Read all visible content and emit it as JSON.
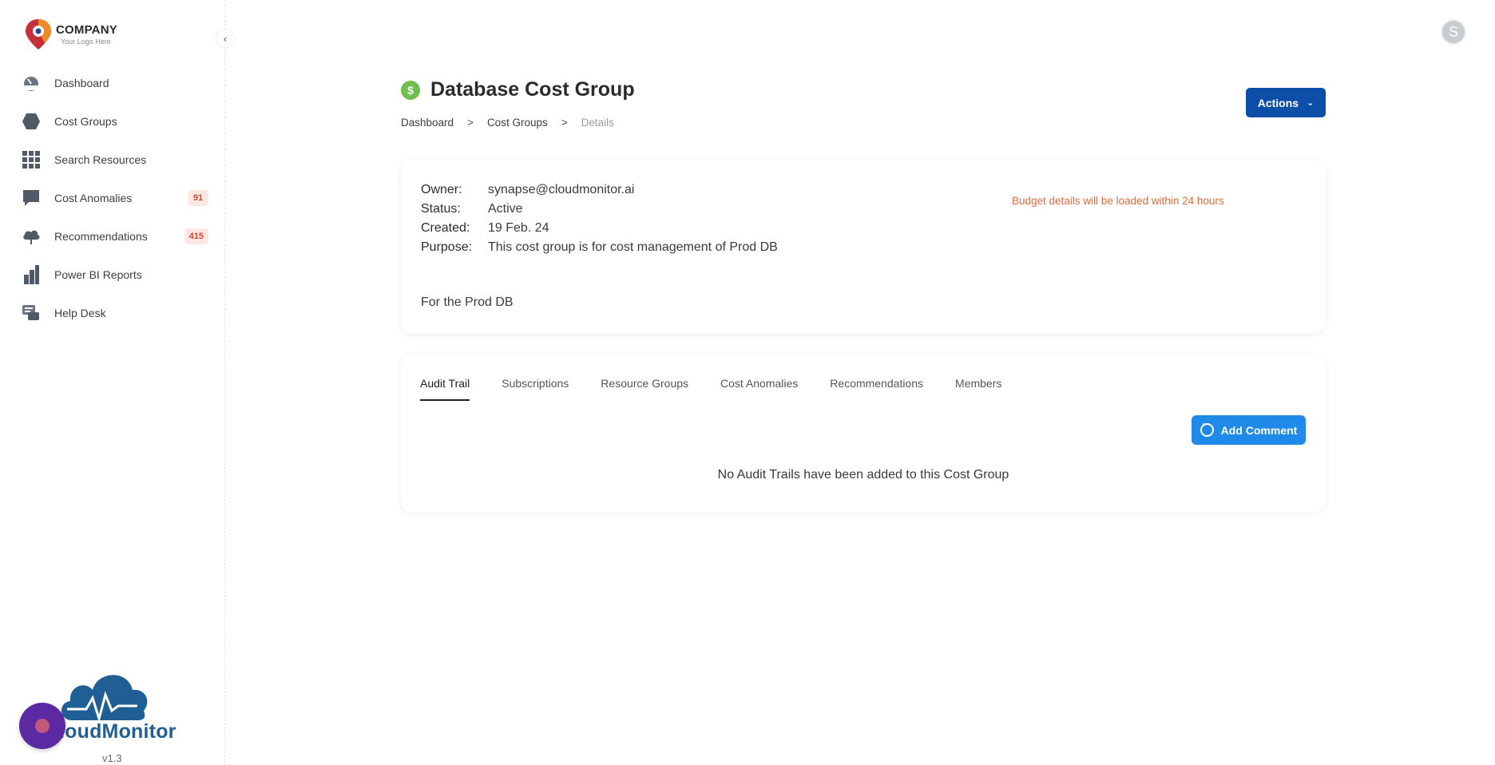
{
  "brand": {
    "company": "COMPANY",
    "tagline": "Your Logo Here",
    "product_name": "loudMonitor",
    "version": "v1.3"
  },
  "sidebar": {
    "collapse_icon": "chevron-left-icon",
    "items": [
      {
        "label": "Dashboard",
        "icon": "gauge-icon"
      },
      {
        "label": "Cost Groups",
        "icon": "hexagon-icon"
      },
      {
        "label": "Search Resources",
        "icon": "grid-icon"
      },
      {
        "label": "Cost Anomalies",
        "icon": "chat-bubble-icon",
        "badge": "91"
      },
      {
        "label": "Recommendations",
        "icon": "cloud-icon",
        "badge": "415"
      },
      {
        "label": "Power BI Reports",
        "icon": "bar-chart-icon"
      },
      {
        "label": "Help Desk",
        "icon": "help-desk-icon"
      }
    ]
  },
  "user": {
    "avatar_initial": "S"
  },
  "header": {
    "title": "Database Cost Group",
    "title_icon": "dollar-icon",
    "breadcrumb": [
      "Dashboard",
      "Cost Groups",
      "Details"
    ],
    "breadcrumb_separator": ">",
    "actions_label": "Actions"
  },
  "details": {
    "owner_label": "Owner:",
    "owner": "synapse@cloudmonitor.ai",
    "status_label": "Status:",
    "status": "Active",
    "created_label": "Created:",
    "created": "19 Feb. 24",
    "purpose_label": "Purpose:",
    "purpose": "This cost group is for cost management of Prod DB",
    "note": "For the Prod DB",
    "budget_note": "Budget details will be loaded within 24 hours"
  },
  "tabs": {
    "items": [
      "Audit Trail",
      "Subscriptions",
      "Resource Groups",
      "Cost Anomalies",
      "Recommendations",
      "Members"
    ],
    "active": "Audit Trail",
    "add_comment_label": "Add Comment",
    "empty_message": "No Audit Trails have been added to this Cost Group"
  },
  "colors": {
    "primary": "#0d4fa8",
    "accent_blue": "#1f8ae8",
    "badge_bg": "#fde7e4",
    "badge_text": "#d6452f",
    "warning_text": "#e06b3a",
    "title_icon": "#6fbf4f"
  }
}
